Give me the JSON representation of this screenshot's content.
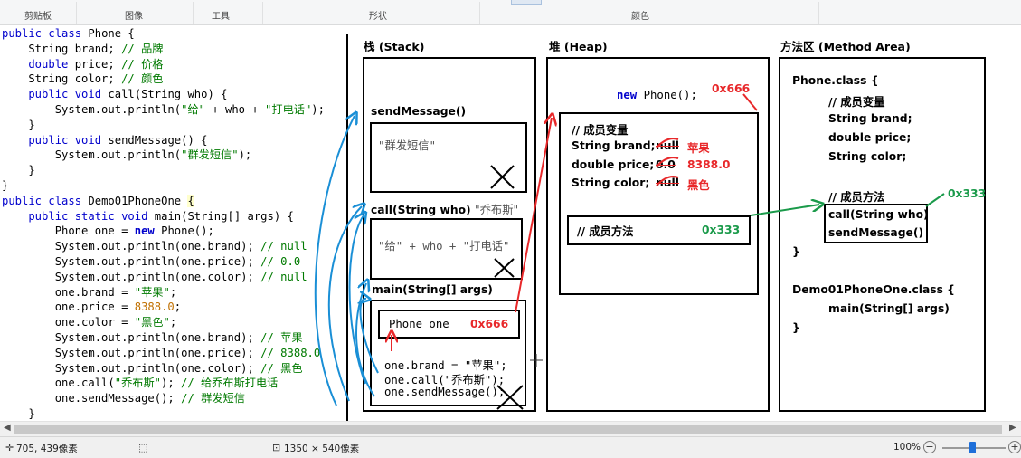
{
  "ribbon": {
    "groups": [
      "剪贴板",
      "图像",
      "工具",
      "形状",
      "颜色"
    ]
  },
  "code": {
    "lines": [
      [
        [
          "kw",
          "public class "
        ],
        [
          "",
          "Phone {"
        ]
      ],
      [
        [
          "",
          "    String brand; "
        ],
        [
          "cm",
          "// 品牌"
        ]
      ],
      [
        [
          "kw",
          "    double"
        ],
        [
          "",
          " price; "
        ],
        [
          "cm",
          "// 价格"
        ]
      ],
      [
        [
          "",
          "    String color; "
        ],
        [
          "cm",
          "// 颜色"
        ]
      ],
      [
        [
          "kw",
          "    public void "
        ],
        [
          "",
          "call(String who) {"
        ]
      ],
      [
        [
          "",
          "        System.out.println("
        ],
        [
          "st",
          "\"给\""
        ],
        [
          "",
          " + who + "
        ],
        [
          "st",
          "\"打电话\""
        ],
        [
          "",
          ");"
        ]
      ],
      [
        [
          "",
          "    }"
        ]
      ],
      [
        [
          "kw",
          "    public void "
        ],
        [
          "",
          "sendMessage() {"
        ]
      ],
      [
        [
          "",
          "        System.out.println("
        ],
        [
          "st",
          "\"群发短信\""
        ],
        [
          "",
          ");"
        ]
      ],
      [
        [
          "",
          "    }"
        ]
      ],
      [
        [
          "",
          "}"
        ]
      ],
      [
        [
          "kw",
          "public class "
        ],
        [
          "",
          "Demo01PhoneOne "
        ],
        [
          "hl",
          "{"
        ]
      ],
      [
        [
          "kw",
          "    public static void "
        ],
        [
          "",
          "main(String[] args) {"
        ]
      ],
      [
        [
          "",
          "        Phone one = "
        ],
        [
          "kwb",
          "new "
        ],
        [
          "",
          "Phone();"
        ]
      ],
      [
        [
          "",
          "        System.out.println(one.brand); "
        ],
        [
          "cm",
          "// null"
        ]
      ],
      [
        [
          "",
          "        System.out.println(one.price); "
        ],
        [
          "cm",
          "// 0.0"
        ]
      ],
      [
        [
          "",
          "        System.out.println(one.color); "
        ],
        [
          "cm",
          "// null"
        ]
      ],
      [
        [
          "",
          "        one.brand = "
        ],
        [
          "st",
          "\"苹果\""
        ],
        [
          "",
          ";"
        ]
      ],
      [
        [
          "",
          "        one.price = "
        ],
        [
          "nm",
          "8388.0"
        ],
        [
          "",
          ";"
        ]
      ],
      [
        [
          "",
          "        one.color = "
        ],
        [
          "st",
          "\"黑色\""
        ],
        [
          "",
          ";"
        ]
      ],
      [
        [
          "",
          "        System.out.println(one.brand); "
        ],
        [
          "cm",
          "// 苹果"
        ]
      ],
      [
        [
          "",
          "        System.out.println(one.price); "
        ],
        [
          "cm",
          "// 8388.0"
        ]
      ],
      [
        [
          "",
          "        System.out.println(one.color); "
        ],
        [
          "cm",
          "// 黑色"
        ]
      ],
      [
        [
          "",
          "        one.call("
        ],
        [
          "st",
          "\"乔布斯\""
        ],
        [
          "",
          "); "
        ],
        [
          "cm",
          "// 给乔布斯打电话"
        ]
      ],
      [
        [
          "",
          "        one.sendMessage(); "
        ],
        [
          "cm",
          "// 群发短信"
        ]
      ],
      [
        [
          "",
          "    }"
        ]
      ]
    ]
  },
  "diagram": {
    "stack": {
      "title": "栈 (Stack)",
      "sendmessage_frame": "sendMessage()",
      "sendmessage_body": "\"群发短信\"",
      "call_frame": "call(String who)",
      "call_arg": "\"乔布斯\"",
      "call_body_1": "\"给\"",
      "call_body_2": " + who + ",
      "call_body_3": "\"打电话\"",
      "main_frame": "main(String[] args)",
      "var_decl": "Phone  one",
      "var_addr": "0x666",
      "stmt_1": "one.brand = \"苹果\";",
      "stmt_2": "one.call(\"乔布斯\");",
      "stmt_3": "one.sendMessage();"
    },
    "heap": {
      "title": "堆 (Heap)",
      "new_kw": "new",
      "new_expr": "Phone();",
      "addr": "0x666",
      "members_title": "// 成员变量",
      "brand_label": "String brand;",
      "brand_old": "null",
      "brand_new": "苹果",
      "price_label": "double price;",
      "price_old": "0.0",
      "price_new": "8388.0",
      "color_label": "String color;",
      "color_old": "null",
      "color_new": "黑色",
      "methods_title": "// 成员方法",
      "methods_addr": "0x333"
    },
    "method_area": {
      "title": "方法区 (Method Area)",
      "phone_class": "Phone.class {",
      "members_title": "// 成员变量",
      "field_1": "String brand;",
      "field_2": "double price;",
      "field_3": "String color;",
      "methods_title": "// 成员方法",
      "methods_addr": "0x333",
      "method_1": "call(String who)",
      "method_2": "sendMessage()",
      "close_1": "}",
      "demo_class": "Demo01PhoneOne.class {",
      "main_method": "main(String[] args)",
      "close_2": "}"
    },
    "colors": {
      "red": "#e8282a",
      "green": "#1a9a4a",
      "blue": "#1a8fd6"
    }
  },
  "status": {
    "cursor_pos": "705, 439像素",
    "image_size": "1350 × 540像素",
    "zoom": "100%",
    "zoom_fraction": 0.47,
    "icons": [
      "cursor-icon",
      "selection-icon",
      "image-size-icon"
    ]
  }
}
